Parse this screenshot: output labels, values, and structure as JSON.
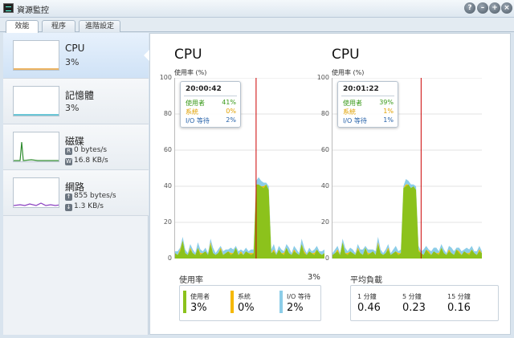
{
  "window": {
    "title": "資源監控"
  },
  "tabs": [
    "效能",
    "程序",
    "進階設定"
  ],
  "sidebar": {
    "items": [
      {
        "title": "CPU",
        "value": "3%"
      },
      {
        "title": "記憶體",
        "value": "3%"
      },
      {
        "title": "磁碟",
        "read_badge": "R",
        "read": "0 bytes/s",
        "write_badge": "W",
        "write": "16.8 KB/s"
      },
      {
        "title": "網路",
        "up": "855 bytes/s",
        "down": "1.3 KB/s"
      }
    ]
  },
  "main": {
    "charts": [
      {
        "title": "CPU",
        "unit": "使用率 (%)",
        "tooltip": {
          "time": "20:00:42",
          "user_label": "使用者",
          "user": "41%",
          "system_label": "系統",
          "system": "0%",
          "io_label": "I/O 等待",
          "io": "2%"
        }
      },
      {
        "title": "CPU",
        "unit": "使用率 (%)",
        "tooltip": {
          "time": "20:01:22",
          "user_label": "使用者",
          "user": "39%",
          "system_label": "系統",
          "system": "1%",
          "io_label": "I/O 等待",
          "io": "1%"
        }
      }
    ],
    "usage": {
      "label": "使用率",
      "total": "3%",
      "user_label": "使用者",
      "user": "3%",
      "system_label": "系統",
      "system": "0%",
      "io_label": "I/O 等待",
      "io": "2%"
    },
    "load": {
      "label": "平均負載",
      "m1_label": "1 分鐘",
      "m1": "0.46",
      "m5_label": "5 分鐘",
      "m5": "0.23",
      "m15_label": "15 分鐘",
      "m15": "0.16"
    }
  },
  "colors": {
    "user": "#8cc21c",
    "system": "#f5b800",
    "io": "#8ccde8",
    "cursor": "#cc0000",
    "disk_line": "#2e8b2e",
    "net_line": "#8a3fc0",
    "cpu_line": "#e69a2e"
  },
  "chart_data": [
    {
      "type": "area",
      "ylabel": "使用率 (%)",
      "ylim": [
        0,
        100
      ],
      "yticks": [
        0,
        20,
        40,
        60,
        80,
        100
      ],
      "grid": true,
      "series": [
        {
          "name": "使用者",
          "values": [
            3,
            2,
            4,
            10,
            3,
            2,
            5,
            3,
            2,
            6,
            2,
            3,
            4,
            2,
            8,
            3,
            2,
            3,
            5,
            2,
            3,
            4,
            2,
            3,
            6,
            2,
            3,
            2,
            4,
            3,
            2,
            3,
            41,
            41,
            40,
            39,
            41,
            38,
            3,
            4,
            2,
            5,
            3,
            2,
            6,
            3,
            2,
            4,
            3,
            2,
            8,
            3,
            2,
            4,
            3,
            2,
            5,
            3,
            2,
            3
          ]
        },
        {
          "name": "系統",
          "values": [
            0,
            0,
            1,
            0,
            0,
            0,
            1,
            0,
            0,
            0,
            1,
            0,
            0,
            0,
            1,
            0,
            0,
            0,
            1,
            0,
            0,
            0,
            1,
            0,
            0,
            0,
            1,
            0,
            0,
            0,
            1,
            0,
            0,
            0,
            0,
            1,
            0,
            0,
            0,
            1,
            0,
            0,
            0,
            1,
            0,
            0,
            0,
            1,
            0,
            0,
            0,
            1,
            0,
            0,
            0,
            1,
            0,
            0,
            0,
            0
          ]
        },
        {
          "name": "I/O 等待",
          "values": [
            1,
            2,
            1,
            2,
            2,
            1,
            2,
            2,
            1,
            3,
            2,
            1,
            2,
            1,
            2,
            3,
            1,
            2,
            1,
            2,
            2,
            1,
            3,
            2,
            1,
            2,
            1,
            2,
            2,
            1,
            2,
            2,
            2,
            4,
            3,
            2,
            1,
            2,
            2,
            3,
            1,
            2,
            2,
            1,
            2,
            3,
            1,
            2,
            2,
            1,
            3,
            2,
            1,
            2,
            1,
            2,
            2,
            1,
            2,
            2
          ]
        }
      ],
      "cursor_index": 32
    },
    {
      "type": "area",
      "ylabel": "使用率 (%)",
      "ylim": [
        0,
        100
      ],
      "yticks": [
        0,
        20,
        40,
        60,
        80,
        100
      ],
      "grid": true,
      "series": [
        {
          "name": "使用者",
          "values": [
            2,
            3,
            4,
            2,
            9,
            3,
            2,
            4,
            3,
            2,
            5,
            3,
            2,
            6,
            2,
            3,
            4,
            2,
            8,
            3,
            2,
            3,
            5,
            2,
            3,
            4,
            2,
            3,
            39,
            40,
            41,
            39,
            40,
            38,
            4,
            3,
            2,
            5,
            3,
            2,
            4,
            3,
            2,
            6,
            3,
            2,
            4,
            3,
            2,
            5,
            3,
            2,
            4,
            3,
            2,
            5,
            3,
            2,
            4,
            3
          ]
        },
        {
          "name": "系統",
          "values": [
            0,
            0,
            1,
            0,
            0,
            0,
            1,
            0,
            0,
            0,
            1,
            0,
            0,
            0,
            1,
            0,
            0,
            0,
            1,
            0,
            0,
            0,
            1,
            0,
            0,
            0,
            1,
            0,
            0,
            1,
            0,
            0,
            0,
            0,
            1,
            0,
            0,
            0,
            1,
            0,
            0,
            0,
            1,
            0,
            0,
            0,
            1,
            0,
            0,
            0,
            1,
            0,
            0,
            0,
            1,
            0,
            0,
            0,
            1,
            0
          ]
        },
        {
          "name": "I/O 等待",
          "values": [
            1,
            2,
            2,
            1,
            2,
            3,
            1,
            2,
            2,
            1,
            2,
            2,
            3,
            1,
            2,
            2,
            1,
            2,
            3,
            2,
            1,
            2,
            2,
            1,
            2,
            3,
            1,
            2,
            1,
            3,
            2,
            2,
            1,
            2,
            2,
            1,
            3,
            2,
            1,
            2,
            2,
            3,
            1,
            2,
            2,
            1,
            2,
            3,
            2,
            1,
            2,
            2,
            1,
            3,
            2,
            2,
            1,
            2,
            2,
            1
          ]
        }
      ],
      "cursor_index": 35
    }
  ]
}
